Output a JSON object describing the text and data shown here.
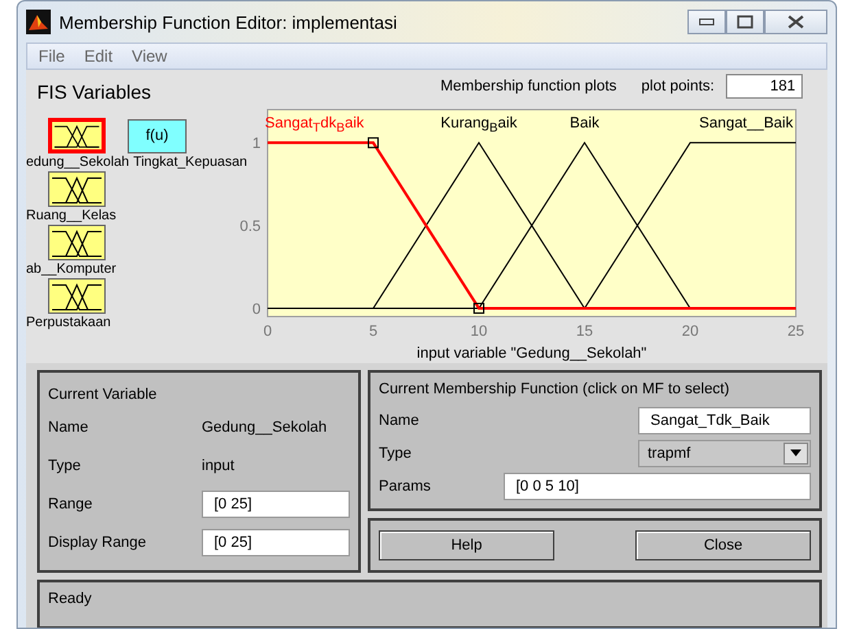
{
  "window": {
    "title": "Membership Function Editor: implementasi"
  },
  "menu": [
    "File",
    "Edit",
    "View"
  ],
  "fis_variables": {
    "title": "FIS Variables",
    "variables": [
      {
        "name": "edung__Sekolah",
        "kind": "input",
        "selected": true
      },
      {
        "name": "Tingkat_Kepuasan",
        "kind": "output",
        "symbol": "f(u)",
        "selected": false
      },
      {
        "name": "Ruang__Kelas",
        "kind": "input",
        "selected": false
      },
      {
        "name": "ab__Komputer",
        "kind": "input",
        "selected": false
      },
      {
        "name": "Perpustakaan",
        "kind": "input",
        "selected": false
      }
    ]
  },
  "plot": {
    "title": "Membership function plots",
    "plot_points_label": "plot points:",
    "plot_points": "181",
    "chart_data": {
      "type": "line",
      "xlabel": "input variable \"Gedung__Sekolah\"",
      "x": [
        0,
        5,
        10,
        15,
        20,
        25
      ],
      "xlim": [
        0,
        25
      ],
      "ylim": [
        -0.05,
        1.2
      ],
      "xticks": [
        0,
        5,
        10,
        15,
        20,
        25
      ],
      "yticks": [
        0,
        0.5,
        1
      ],
      "series": [
        {
          "name": "Sangat$_{T}$dk$_{B}$aik",
          "color": "#ff0000",
          "values": [
            1,
            1,
            0,
            0,
            0,
            0
          ]
        },
        {
          "name": "Kurang$_{B}$aik",
          "color": "#000000",
          "values": [
            0,
            0,
            1,
            0,
            0,
            0
          ]
        },
        {
          "name": "Baik",
          "color": "#000000",
          "values": [
            0,
            0,
            0,
            1,
            0,
            0
          ]
        },
        {
          "name": "Sangat__Baik",
          "color": "#000000",
          "values": [
            0,
            0,
            0,
            0,
            1,
            1
          ]
        }
      ]
    },
    "membership_functions": [
      {
        "selected": true
      },
      {
        "selected": false
      },
      {
        "selected": false
      },
      {
        "selected": false
      }
    ]
  },
  "current_variable": {
    "title": "Current Variable",
    "name_label": "Name",
    "name": "Gedung__Sekolah",
    "type_label": "Type",
    "type": "input",
    "range_label": "Range",
    "range": "[0 25]",
    "display_range_label": "Display Range",
    "display_range": "[0 25]"
  },
  "current_mf": {
    "title": "Current Membership Function (click on MF to select)",
    "name_label": "Name",
    "name": "Sangat_Tdk_Baik",
    "type_label": "Type",
    "type": "trapmf",
    "params_label": "Params",
    "params": "[0 0 5 10]"
  },
  "buttons": [
    "Help",
    "Close"
  ],
  "status": "Ready"
}
